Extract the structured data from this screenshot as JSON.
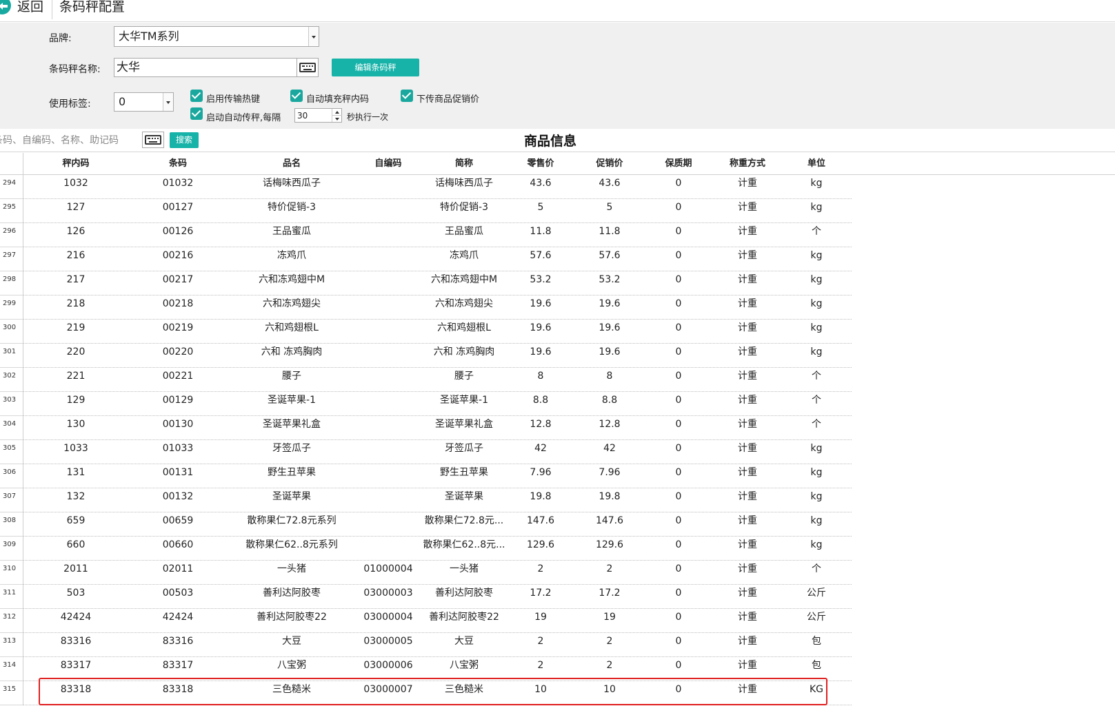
{
  "header": {
    "back_label": "返回",
    "title": "条码秤配置"
  },
  "config": {
    "brand_label": "品牌:",
    "brand_value": "大华TM系列",
    "scale_name_label": "条码秤名称:",
    "scale_name_value": "大华",
    "edit_scale_button": "编辑条码秤",
    "use_label_label": "使用标签:",
    "use_label_value": "0",
    "enable_hotkey": "启用传输热键",
    "auto_fill_code": "自动填充秤内码",
    "upload_promo_price": "下传商品促销价",
    "auto_transfer": "启动自动传秤,每隔",
    "interval_value": "30",
    "interval_suffix": "秒执行一次"
  },
  "search": {
    "placeholder": "条码、自编码、名称、助记码",
    "button": "搜索"
  },
  "section_title": "商品信息",
  "columns": [
    "秤内码",
    "条码",
    "品名",
    "自编码",
    "简称",
    "零售价",
    "促销价",
    "保质期",
    "称重方式",
    "单位"
  ],
  "rows": [
    {
      "n": "294",
      "c": [
        "1032",
        "01032",
        "话梅味西瓜子",
        "",
        "话梅味西瓜子",
        "43.6",
        "43.6",
        "0",
        "计重",
        "kg"
      ]
    },
    {
      "n": "295",
      "c": [
        "127",
        "00127",
        "特价促销-3",
        "",
        "特价促销-3",
        "5",
        "5",
        "0",
        "计重",
        "kg"
      ]
    },
    {
      "n": "296",
      "c": [
        "126",
        "00126",
        "王品蜜瓜",
        "",
        "王品蜜瓜",
        "11.8",
        "11.8",
        "0",
        "计重",
        "个"
      ]
    },
    {
      "n": "297",
      "c": [
        "216",
        "00216",
        "冻鸡爪",
        "",
        "冻鸡爪",
        "57.6",
        "57.6",
        "0",
        "计重",
        "kg"
      ]
    },
    {
      "n": "298",
      "c": [
        "217",
        "00217",
        "六和冻鸡翅中M",
        "",
        "六和冻鸡翅中M",
        "53.2",
        "53.2",
        "0",
        "计重",
        "kg"
      ]
    },
    {
      "n": "299",
      "c": [
        "218",
        "00218",
        "六和冻鸡翅尖",
        "",
        "六和冻鸡翅尖",
        "19.6",
        "19.6",
        "0",
        "计重",
        "kg"
      ]
    },
    {
      "n": "300",
      "c": [
        "219",
        "00219",
        "六和鸡翅根L",
        "",
        "六和鸡翅根L",
        "19.6",
        "19.6",
        "0",
        "计重",
        "kg"
      ]
    },
    {
      "n": "301",
      "c": [
        "220",
        "00220",
        "六和 冻鸡胸肉",
        "",
        "六和 冻鸡胸肉",
        "19.6",
        "19.6",
        "0",
        "计重",
        "kg"
      ]
    },
    {
      "n": "302",
      "c": [
        "221",
        "00221",
        "腰子",
        "",
        "腰子",
        "8",
        "8",
        "0",
        "计重",
        "个"
      ]
    },
    {
      "n": "303",
      "c": [
        "129",
        "00129",
        "圣诞苹果-1",
        "",
        "圣诞苹果-1",
        "8.8",
        "8.8",
        "0",
        "计重",
        "个"
      ]
    },
    {
      "n": "304",
      "c": [
        "130",
        "00130",
        "圣诞苹果礼盒",
        "",
        "圣诞苹果礼盒",
        "12.8",
        "12.8",
        "0",
        "计重",
        "个"
      ]
    },
    {
      "n": "305",
      "c": [
        "1033",
        "01033",
        "牙签瓜子",
        "",
        "牙签瓜子",
        "42",
        "42",
        "0",
        "计重",
        "kg"
      ]
    },
    {
      "n": "306",
      "c": [
        "131",
        "00131",
        "野生丑苹果",
        "",
        "野生丑苹果",
        "7.96",
        "7.96",
        "0",
        "计重",
        "kg"
      ]
    },
    {
      "n": "307",
      "c": [
        "132",
        "00132",
        "圣诞苹果",
        "",
        "圣诞苹果",
        "19.8",
        "19.8",
        "0",
        "计重",
        "kg"
      ]
    },
    {
      "n": "308",
      "c": [
        "659",
        "00659",
        "散称果仁72.8元系列",
        "",
        "散称果仁72.8元...",
        "147.6",
        "147.6",
        "0",
        "计重",
        "kg"
      ]
    },
    {
      "n": "309",
      "c": [
        "660",
        "00660",
        "散称果仁62..8元系列",
        "",
        "散称果仁62..8元...",
        "129.6",
        "129.6",
        "0",
        "计重",
        "kg"
      ]
    },
    {
      "n": "310",
      "c": [
        "2011",
        "02011",
        "一头猪",
        "01000004",
        "一头猪",
        "2",
        "2",
        "0",
        "计重",
        "个"
      ]
    },
    {
      "n": "311",
      "c": [
        "503",
        "00503",
        "善利达阿胶枣",
        "03000003",
        "善利达阿胶枣",
        "17.2",
        "17.2",
        "0",
        "计重",
        "公斤"
      ]
    },
    {
      "n": "312",
      "c": [
        "42424",
        "42424",
        "善利达阿胶枣22",
        "03000004",
        "善利达阿胶枣22",
        "19",
        "19",
        "0",
        "计重",
        "公斤"
      ]
    },
    {
      "n": "313",
      "c": [
        "83316",
        "83316",
        "大豆",
        "03000005",
        "大豆",
        "2",
        "2",
        "0",
        "计重",
        "包"
      ]
    },
    {
      "n": "314",
      "c": [
        "83317",
        "83317",
        "八宝粥",
        "03000006",
        "八宝粥",
        "2",
        "2",
        "0",
        "计重",
        "包"
      ]
    },
    {
      "n": "315",
      "c": [
        "83318",
        "83318",
        "三色糙米",
        "03000007",
        "三色糙米",
        "10",
        "10",
        "0",
        "计重",
        "KG"
      ]
    }
  ],
  "colors": {
    "accent": "#17b3a9",
    "highlight": "#e02020"
  }
}
